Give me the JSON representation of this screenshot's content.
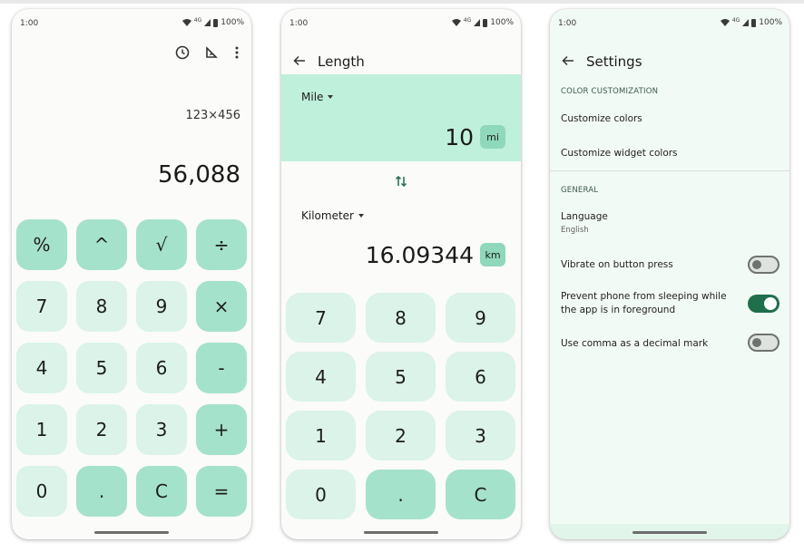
{
  "status": {
    "time": "1:00",
    "network": "4G",
    "battery": "100%"
  },
  "calculator": {
    "expression": "123×456",
    "result": "56,088",
    "keys": [
      {
        "label": "%",
        "style": "mid"
      },
      {
        "label": "^",
        "style": "mid"
      },
      {
        "label": "√",
        "style": "mid"
      },
      {
        "label": "÷",
        "style": "mid"
      },
      {
        "label": "7",
        "style": "light"
      },
      {
        "label": "8",
        "style": "light"
      },
      {
        "label": "9",
        "style": "light"
      },
      {
        "label": "×",
        "style": "mid"
      },
      {
        "label": "4",
        "style": "light"
      },
      {
        "label": "5",
        "style": "light"
      },
      {
        "label": "6",
        "style": "light"
      },
      {
        "label": "-",
        "style": "mid"
      },
      {
        "label": "1",
        "style": "light"
      },
      {
        "label": "2",
        "style": "light"
      },
      {
        "label": "3",
        "style": "light"
      },
      {
        "label": "+",
        "style": "mid"
      },
      {
        "label": "0",
        "style": "light"
      },
      {
        "label": ".",
        "style": "mid"
      },
      {
        "label": "C",
        "style": "mid"
      },
      {
        "label": "=",
        "style": "mid"
      }
    ]
  },
  "converter": {
    "title": "Length",
    "from": {
      "unit": "Mile",
      "value": "10",
      "symbol": "mi"
    },
    "to": {
      "unit": "Kilometer",
      "value": "16.09344",
      "symbol": "km"
    },
    "keys": [
      {
        "label": "7",
        "style": "light"
      },
      {
        "label": "8",
        "style": "light"
      },
      {
        "label": "9",
        "style": "light"
      },
      {
        "label": "4",
        "style": "light"
      },
      {
        "label": "5",
        "style": "light"
      },
      {
        "label": "6",
        "style": "light"
      },
      {
        "label": "1",
        "style": "light"
      },
      {
        "label": "2",
        "style": "light"
      },
      {
        "label": "3",
        "style": "light"
      },
      {
        "label": "0",
        "style": "light"
      },
      {
        "label": ".",
        "style": "mid"
      },
      {
        "label": "C",
        "style": "mid"
      }
    ]
  },
  "settings": {
    "title": "Settings",
    "color_section": "COLOR CUSTOMIZATION",
    "customize_colors": "Customize colors",
    "customize_widget_colors": "Customize widget colors",
    "general_section": "GENERAL",
    "language_label": "Language",
    "language_value": "English",
    "vibrate_label": "Vibrate on button press",
    "vibrate_on": false,
    "prevent_sleep_label_1": "Prevent phone from sleeping while",
    "prevent_sleep_label_2": "the app is in foreground",
    "prevent_sleep_on": true,
    "comma_label": "Use comma as a decimal mark",
    "comma_on": false
  },
  "colors": {
    "accent": "#a5e2cb",
    "light_key": "#dbf3e8",
    "toggle_on": "#1f6e4c",
    "converter_header": "#bff0dc"
  },
  "icons": [
    "history-icon",
    "ruler-icon",
    "more-vert-icon",
    "back-arrow-icon",
    "swap-icon",
    "wifi-icon",
    "battery-icon"
  ]
}
